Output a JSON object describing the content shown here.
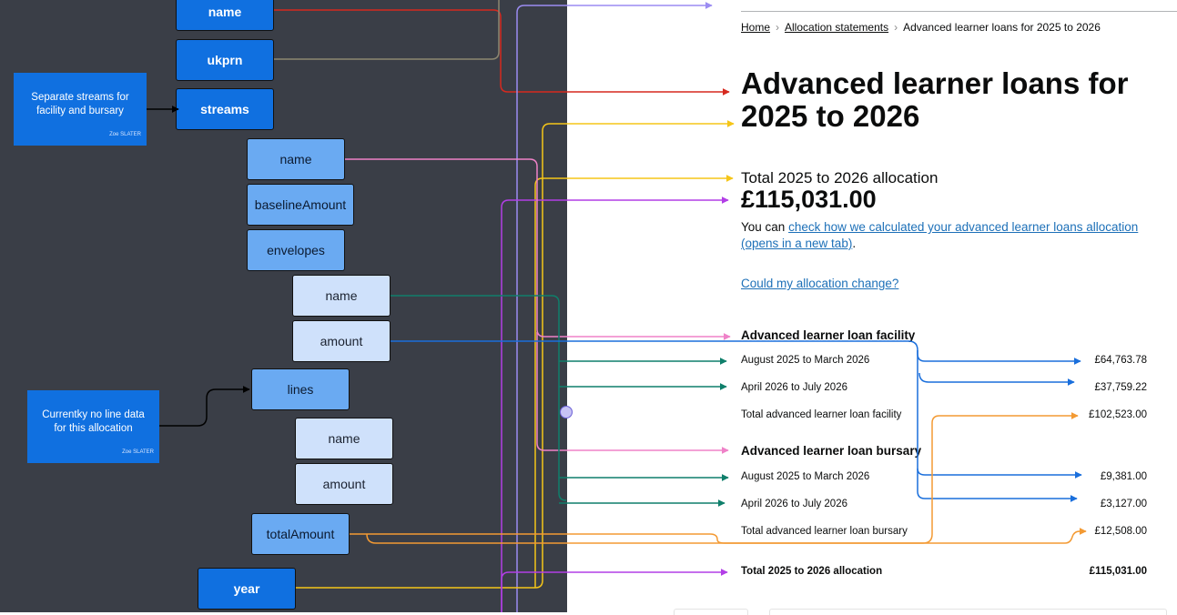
{
  "diagram": {
    "fields": {
      "name_top": "name",
      "ukprn": "ukprn",
      "streams": "streams",
      "stream_name": "name",
      "baseline_amount": "baselineAmount",
      "envelopes": "envelopes",
      "envelope_name": "name",
      "envelope_amount": "amount",
      "lines": "lines",
      "line_name": "name",
      "line_amount": "amount",
      "total_amount": "totalAmount",
      "year": "year"
    },
    "notes": {
      "streams_note": "Separate streams for facility and bursary",
      "streams_note_author": "Zoe SLATER",
      "lines_note": "Currentky no line data for this allocation",
      "lines_note_author": "Zoe SLATER"
    },
    "colors": {
      "red": "#d6291f",
      "khaki": "#8d8770",
      "violet": "#9b8cf2",
      "yellow": "#f5c518",
      "pink": "#ef82c8",
      "purple": "#b23ee6",
      "green": "#0f7f6b",
      "blue": "#1a6fdc",
      "orange": "#f39a33",
      "black": "#000000"
    }
  },
  "page": {
    "breadcrumbs": [
      "Home",
      "Allocation statements",
      "Advanced learner loans for 2025 to 2026"
    ],
    "title": "Advanced learner loans for 2025 to 2026",
    "total_label": "Total 2025 to 2026 allocation",
    "total_amount": "£115,031.00",
    "calc_prefix": "You can ",
    "calc_link": "check how we calculated your advanced learner loans allocation (opens in a new tab)",
    "calc_suffix": ".",
    "change_link": "Could my allocation change?",
    "facility": {
      "heading": "Advanced learner loan facility",
      "rows": [
        {
          "label": "August 2025 to March 2026",
          "amount": "£64,763.78"
        },
        {
          "label": "April 2026 to July 2026",
          "amount": "£37,759.22"
        },
        {
          "label": "Total advanced learner loan facility",
          "amount": "£102,523.00"
        }
      ]
    },
    "bursary": {
      "heading": "Advanced learner loan bursary",
      "rows": [
        {
          "label": "August 2025 to March 2026",
          "amount": "£9,381.00"
        },
        {
          "label": "April 2026 to July 2026",
          "amount": "£3,127.00"
        },
        {
          "label": "Total advanced learner loan bursary",
          "amount": "£12,508.00"
        }
      ]
    },
    "grand_total": {
      "label": "Total 2025 to 2026 allocation",
      "amount": "£115,031.00"
    }
  }
}
